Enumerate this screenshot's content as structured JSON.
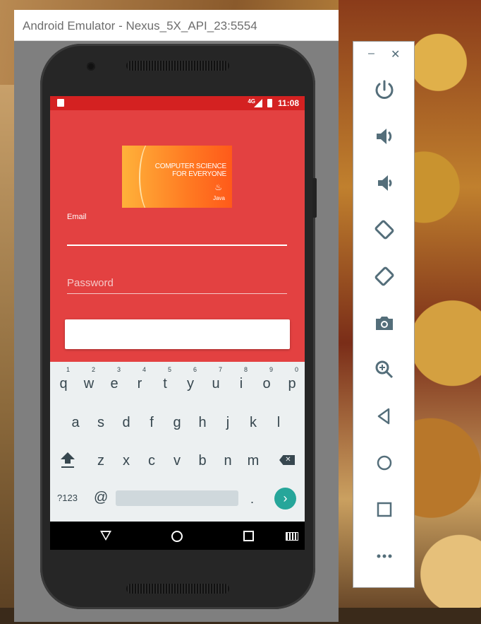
{
  "window": {
    "title": "Android Emulator - Nexus_5X_API_23:5554"
  },
  "statusbar": {
    "network": "4G",
    "time": "11:08"
  },
  "banner": {
    "line1": "COMPUTER SCIENCE",
    "line2": "FOR EVERYONE",
    "brand": "Java"
  },
  "form": {
    "email_label": "Email",
    "password_placeholder": "Password"
  },
  "keyboard": {
    "row1": [
      {
        "k": "q",
        "n": "1"
      },
      {
        "k": "w",
        "n": "2"
      },
      {
        "k": "e",
        "n": "3"
      },
      {
        "k": "r",
        "n": "4"
      },
      {
        "k": "t",
        "n": "5"
      },
      {
        "k": "y",
        "n": "6"
      },
      {
        "k": "u",
        "n": "7"
      },
      {
        "k": "i",
        "n": "8"
      },
      {
        "k": "o",
        "n": "9"
      },
      {
        "k": "p",
        "n": "0"
      }
    ],
    "row2": [
      "a",
      "s",
      "d",
      "f",
      "g",
      "h",
      "j",
      "k",
      "l"
    ],
    "row3": [
      "z",
      "x",
      "c",
      "v",
      "b",
      "n",
      "m"
    ],
    "symbols_key": "?123",
    "at_key": "@",
    "period_key": ".",
    "enter_key": "›"
  },
  "toolbar": {
    "minimize": "–",
    "close": "✕",
    "buttons": [
      "power-icon",
      "volume-up-icon",
      "volume-down-icon",
      "rotate-left-icon",
      "rotate-right-icon",
      "camera-icon",
      "zoom-icon",
      "back-icon",
      "home-icon",
      "overview-icon",
      "more-icon"
    ]
  },
  "colors": {
    "app_background": "#e34141",
    "status_bar": "#d42121",
    "keyboard_background": "#ecf0f1",
    "enter_key": "#26a69a",
    "toolbar_icons": "#546e7a"
  }
}
